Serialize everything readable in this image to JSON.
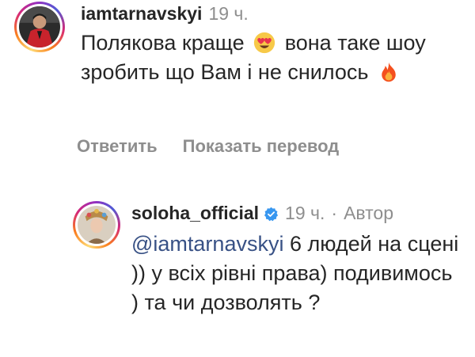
{
  "comment": {
    "username": "iamtarnavskyi",
    "time": "19 ч.",
    "text_part1": "Полякова краще",
    "text_part2": "вона таке шоу зробить що Вам і не снилось",
    "emoji1": "heart-eyes-emoji",
    "emoji2": "fire-emoji"
  },
  "actions": {
    "reply": "Ответить",
    "translate": "Показать перевод"
  },
  "reply": {
    "username": "soloha_official",
    "time": "19 ч.",
    "separator": "·",
    "author_label": "Автор",
    "mention": "@iamtarnavskyi",
    "text": "6 людей на сцені )) у всіх рівні права) подивимось ) та чи дозволять ?"
  },
  "colors": {
    "text": "#262626",
    "secondary": "#8e8e8e",
    "link": "#385185",
    "verified": "#3897f0"
  }
}
